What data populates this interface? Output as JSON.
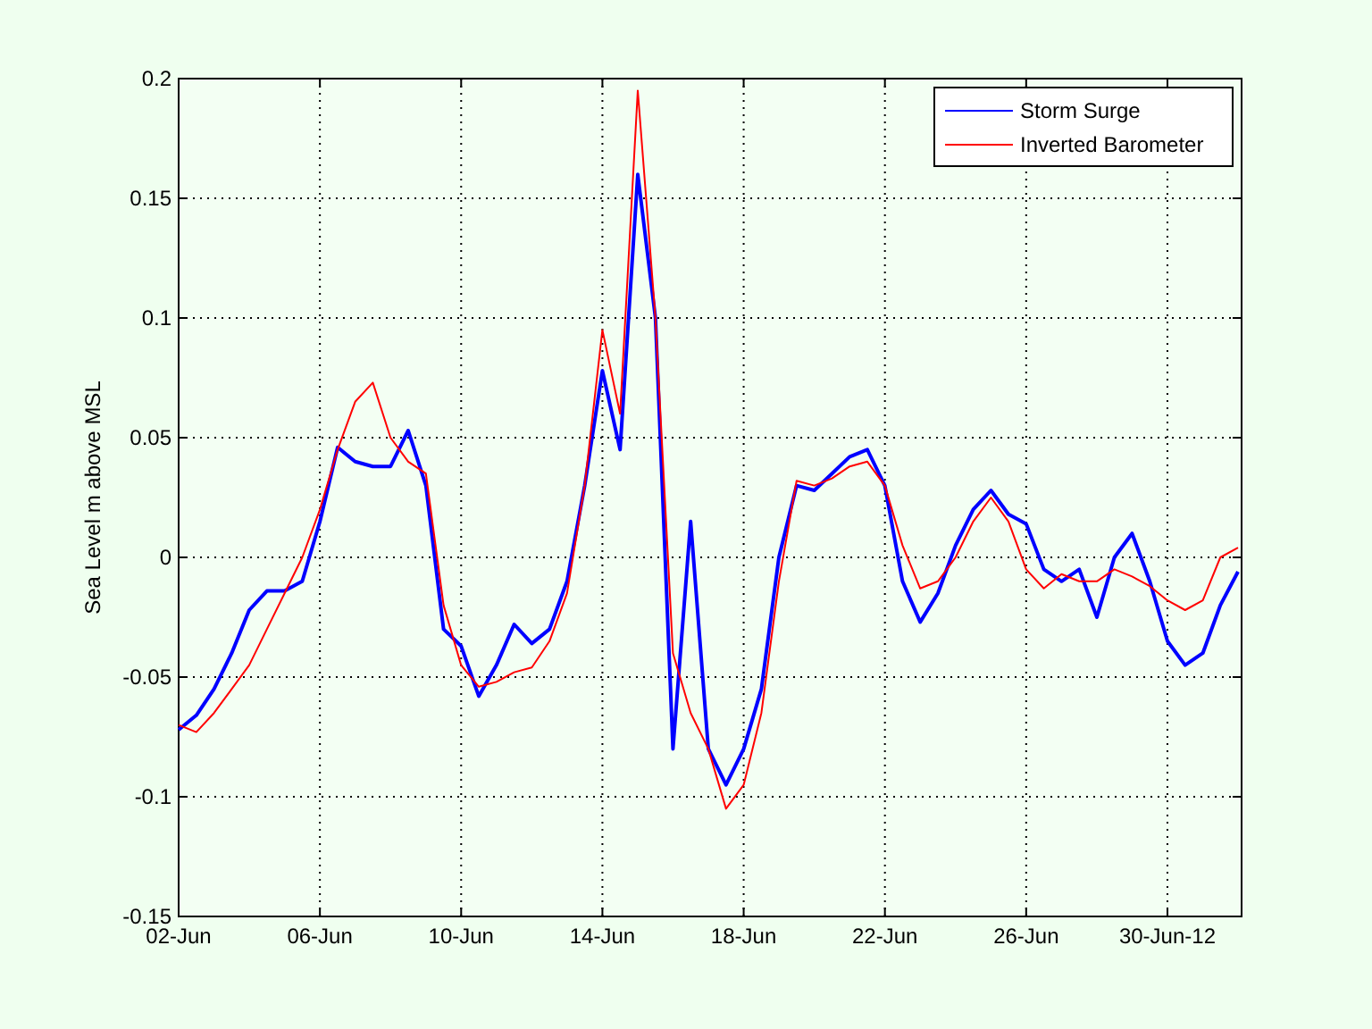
{
  "figure": {
    "chart_data": {
      "type": "line",
      "ylabel": "Sea Level m above MSL",
      "categories": [
        "02-Jun",
        null,
        null,
        null,
        null,
        null,
        null,
        null,
        "06-Jun",
        null,
        null,
        null,
        null,
        null,
        null,
        null,
        "10-Jun",
        null,
        null,
        null,
        null,
        null,
        null,
        null,
        "14-Jun",
        null,
        null,
        null,
        null,
        null,
        null,
        null,
        "18-Jun",
        null,
        null,
        null,
        null,
        null,
        null,
        null,
        "22-Jun",
        null,
        null,
        null,
        null,
        null,
        null,
        null,
        "26-Jun",
        null,
        null,
        null,
        null,
        null,
        null,
        null,
        "30-Jun-12",
        null,
        null,
        null,
        null
      ],
      "grid": true,
      "legend": true,
      "ylim": [
        -0.15,
        0.2
      ],
      "yticks": [
        {
          "value": 0.2,
          "label": "0.2"
        },
        {
          "value": 0.15,
          "label": "0.15"
        },
        {
          "value": 0.1,
          "label": "0.1"
        },
        {
          "value": 0.05,
          "label": "0.05"
        },
        {
          "value": 0,
          "label": "0"
        },
        {
          "value": -0.05,
          "label": "-0.05"
        },
        {
          "value": -0.1,
          "label": "-0.1"
        },
        {
          "value": -0.15,
          "label": "-0.15"
        }
      ],
      "series": [
        {
          "name": "Storm Surge",
          "color": "#0000ff",
          "values": [
            -0.072,
            -0.066,
            -0.055,
            -0.04,
            -0.022,
            -0.014,
            -0.014,
            -0.01,
            0.015,
            0.046,
            0.04,
            0.038,
            0.038,
            0.053,
            0.03,
            -0.03,
            -0.037,
            -0.058,
            -0.045,
            -0.028,
            -0.036,
            -0.03,
            -0.01,
            0.03,
            0.078,
            0.045,
            0.16,
            0.1,
            -0.08,
            0.015,
            -0.08,
            -0.095,
            -0.08,
            -0.055,
            0.0,
            0.03,
            0.028,
            0.035,
            0.042,
            0.045,
            0.03,
            -0.01,
            -0.027,
            -0.015,
            0.005,
            0.02,
            0.028,
            0.018,
            0.014,
            -0.005,
            -0.01,
            -0.005,
            -0.025,
            0.0,
            0.01,
            -0.01,
            -0.035,
            -0.045,
            -0.04,
            -0.02,
            -0.006
          ]
        },
        {
          "name": "Inverted Barometer",
          "color": "#ff0000",
          "values": [
            -0.07,
            -0.073,
            -0.065,
            -0.055,
            -0.045,
            -0.03,
            -0.015,
            0.0,
            0.02,
            0.045,
            0.065,
            0.073,
            0.05,
            0.04,
            0.035,
            -0.02,
            -0.045,
            -0.054,
            -0.052,
            -0.048,
            -0.046,
            -0.035,
            -0.015,
            0.03,
            0.095,
            0.06,
            0.195,
            0.1,
            -0.04,
            -0.065,
            -0.08,
            -0.105,
            -0.095,
            -0.065,
            -0.01,
            0.032,
            0.03,
            0.033,
            0.038,
            0.04,
            0.03,
            0.005,
            -0.013,
            -0.01,
            0.0,
            0.015,
            0.025,
            0.015,
            -0.005,
            -0.013,
            -0.007,
            -0.01,
            -0.01,
            -0.005,
            -0.008,
            -0.012,
            -0.018,
            -0.022,
            -0.018,
            0.0,
            0.004
          ]
        }
      ]
    }
  }
}
